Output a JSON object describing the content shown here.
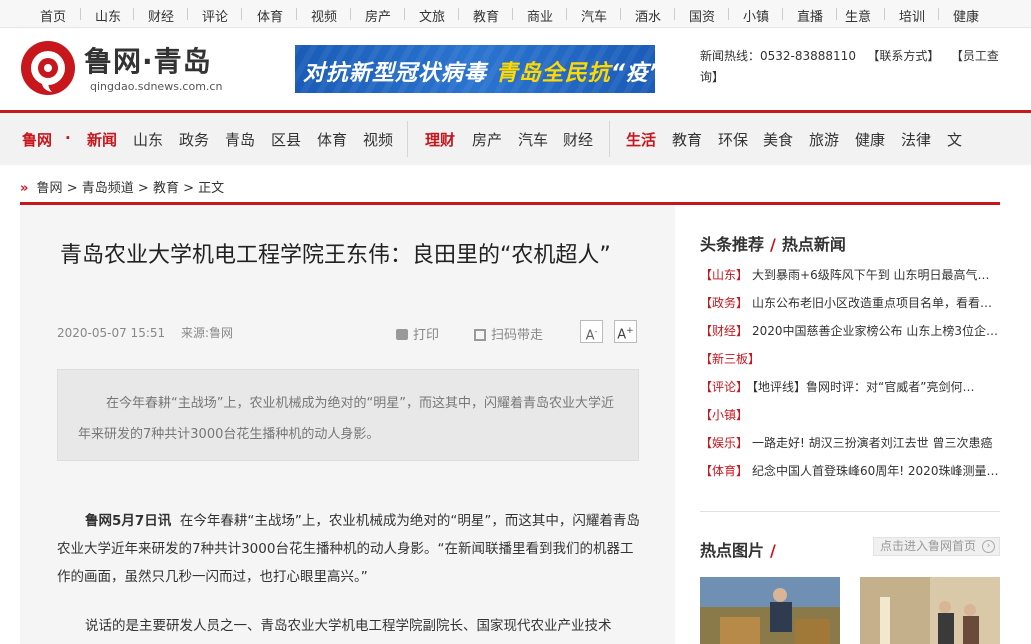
{
  "top_nav": [
    "首页",
    "山东",
    "财经",
    "评论",
    "体育",
    "视频",
    "房产",
    "文旅",
    "教育",
    "商业",
    "汽车",
    "酒水",
    "国资",
    "小镇",
    "直播",
    "生意",
    "培训",
    "健康"
  ],
  "header": {
    "logo_text": "鲁网·青岛",
    "logo_url": "qingdao.sdnews.com.cn",
    "banner": {
      "part1": "对抗新型冠状病毒",
      "part2": "青岛全民抗",
      "part3": "“疫”"
    },
    "hotline": "新闻热线：0532-83888110",
    "contact": "【联系方式】",
    "staff": "【员工查询】"
  },
  "main_nav": {
    "group1": [
      "鲁网",
      "·",
      "新闻",
      "山东",
      "政务",
      "青岛",
      "区县",
      "体育",
      "视频"
    ],
    "group2": [
      "理财",
      "房产",
      "汽车",
      "财经"
    ],
    "group3": [
      "生活",
      "教育",
      "环保",
      "美食",
      "旅游",
      "健康",
      "法律",
      "文"
    ]
  },
  "breadcrumb": [
    "鲁网",
    "青岛频道",
    "教育",
    "正文"
  ],
  "article": {
    "title": "青岛农业大学机电工程学院王东伟：良田里的“农机超人”",
    "date": "2020-05-07 15:51",
    "source": "来源:鲁网",
    "print": "打印",
    "qr": "扫码带走",
    "font_smaller": "A",
    "font_larger": "A",
    "summary": "在今年春耕“主战场”上，农业机械成为绝对的“明星”，而这其中，闪耀着青岛农业大学近年来研发的7种共计3000台花生播种机的动人身影。",
    "p1_lead": "鲁网5月7日讯",
    "p1_text": "在今年春耕“主战场”上，农业机械成为绝对的“明星”，而这其中，闪耀着青岛农业大学近年来研发的7种共计3000台花生播种机的动人身影。“在新闻联播里看到我们的机器工作的画面，虽然只几秒一闪而过，也打心眼里高兴。”",
    "p2_text": "说话的是主要研发人员之一、青岛农业大学机电工程学院副院长、国家现代农业产业技术"
  },
  "sidebar": {
    "tab1": "头条推荐",
    "tab2": "热点新闻",
    "news": [
      {
        "cat": "【山东】",
        "title": "大到暴雨+6级阵风下午到 山东明日最高气…"
      },
      {
        "cat": "【政务】",
        "title": "山东公布老旧小区改造重点项目名单，看看…"
      },
      {
        "cat": "【财经】",
        "title": "2020中国慈善企业家榜公布 山东上榜3位企…"
      },
      {
        "cat": "【新三板】",
        "title": ""
      },
      {
        "cat": "【评论】",
        "title": "【地评线】鲁网时评：对“官威者”亮剑何…"
      },
      {
        "cat": "【小镇】",
        "title": ""
      },
      {
        "cat": "【娱乐】",
        "title": "一路走好! 胡汉三扮演者刘江去世 曾三次患癌"
      },
      {
        "cat": "【体育】",
        "title": "纪念中国人首登珠峰60周年! 2020珠峰测量…"
      }
    ],
    "pics_title": "热点图片",
    "pics_link": "点击进入鲁网首页"
  },
  "colors": {
    "accent": "#c8161d",
    "banner_blue": "#1a5cb8"
  }
}
